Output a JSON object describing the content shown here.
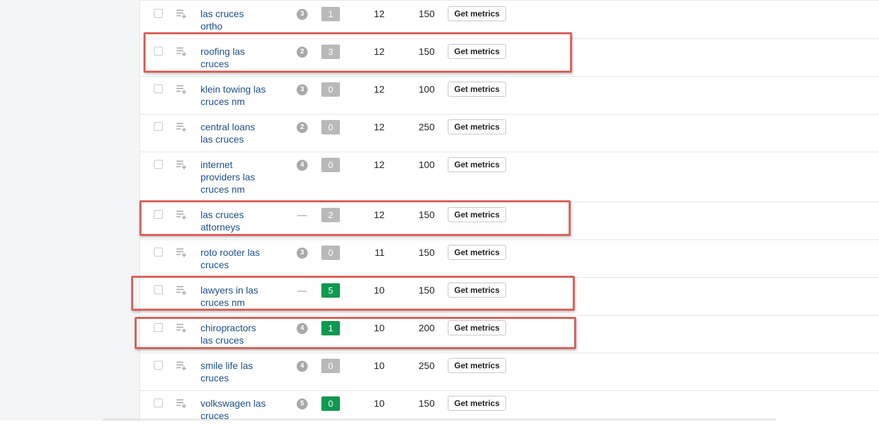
{
  "action_label": "Get metrics",
  "rows": [
    {
      "keyword": [
        "las cruces",
        "ortho"
      ],
      "intent": "3",
      "kd": "1",
      "kd_color": "#b9b9b9",
      "volume": "12",
      "cpc": "150"
    },
    {
      "keyword": [
        "roofing las",
        "cruces"
      ],
      "intent": "2",
      "kd": "3",
      "kd_color": "#b9b9b9",
      "volume": "12",
      "cpc": "150"
    },
    {
      "keyword": [
        "klein towing las",
        "cruces nm"
      ],
      "intent": "3",
      "kd": "0",
      "kd_color": "#b9b9b9",
      "volume": "12",
      "cpc": "100"
    },
    {
      "keyword": [
        "central loans",
        "las cruces"
      ],
      "intent": "2",
      "kd": "0",
      "kd_color": "#b9b9b9",
      "volume": "12",
      "cpc": "250"
    },
    {
      "keyword": [
        "internet",
        "providers las",
        "cruces nm"
      ],
      "intent": "4",
      "kd": "0",
      "kd_color": "#b9b9b9",
      "volume": "12",
      "cpc": "100"
    },
    {
      "keyword": [
        "las cruces",
        "attorneys"
      ],
      "intent": "—",
      "kd": "2",
      "kd_color": "#b9b9b9",
      "volume": "12",
      "cpc": "150"
    },
    {
      "keyword": [
        "roto rooter las",
        "cruces"
      ],
      "intent": "3",
      "kd": "0",
      "kd_color": "#b9b9b9",
      "volume": "11",
      "cpc": "150"
    },
    {
      "keyword": [
        "lawyers in las",
        "cruces nm"
      ],
      "intent": "—",
      "kd": "5",
      "kd_color": "#0e9850",
      "volume": "10",
      "cpc": "150"
    },
    {
      "keyword": [
        "chiropractors",
        "las cruces"
      ],
      "intent": "4",
      "kd": "1",
      "kd_color": "#0e9850",
      "volume": "10",
      "cpc": "200"
    },
    {
      "keyword": [
        "smile life las",
        "cruces"
      ],
      "intent": "4",
      "kd": "0",
      "kd_color": "#b9b9b9",
      "volume": "10",
      "cpc": "250"
    },
    {
      "keyword": [
        "volkswagen las",
        "cruces"
      ],
      "intent": "5",
      "kd": "0",
      "kd_color": "#0e9850",
      "volume": "10",
      "cpc": "150"
    }
  ],
  "highlight_color": "#d9625a",
  "highlighted_keywords": [
    "roofing las cruces",
    "las cruces attorneys",
    "lawyers in las cruces nm",
    "chiropractors las cruces"
  ]
}
